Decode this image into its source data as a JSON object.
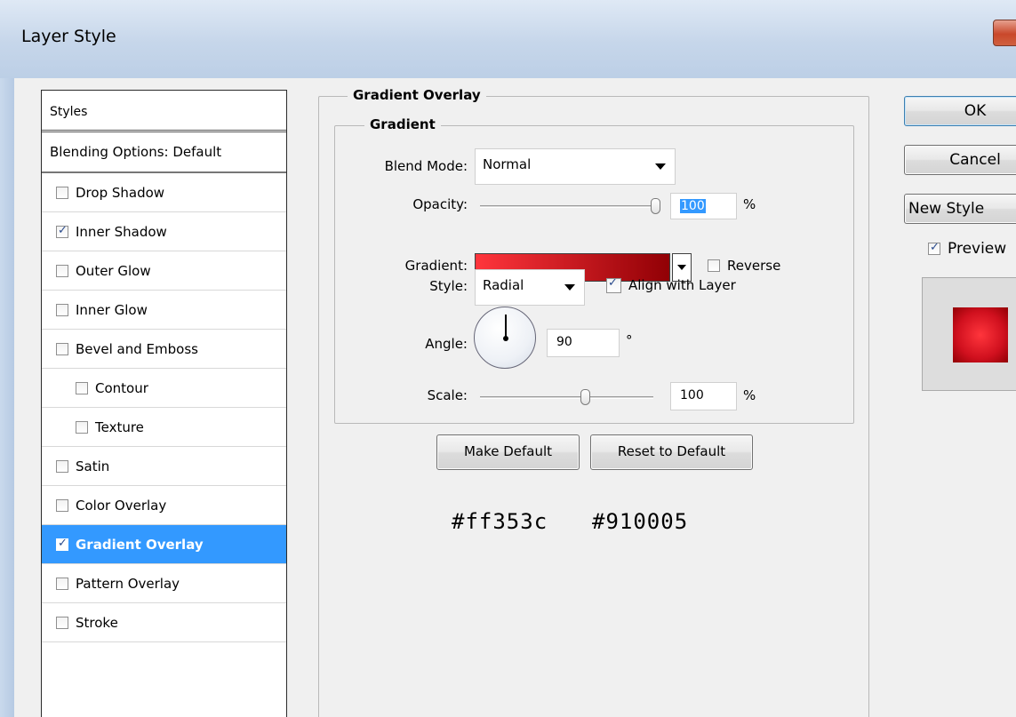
{
  "window": {
    "title": "Layer Style"
  },
  "styles_list": {
    "header": "Styles",
    "blending_options": "Blending Options: Default",
    "items": [
      {
        "label": "Drop Shadow",
        "checked": false,
        "sub": false,
        "selected": false
      },
      {
        "label": "Inner Shadow",
        "checked": true,
        "sub": false,
        "selected": false
      },
      {
        "label": "Outer Glow",
        "checked": false,
        "sub": false,
        "selected": false
      },
      {
        "label": "Inner Glow",
        "checked": false,
        "sub": false,
        "selected": false
      },
      {
        "label": "Bevel and Emboss",
        "checked": false,
        "sub": false,
        "selected": false
      },
      {
        "label": "Contour",
        "checked": false,
        "sub": true,
        "selected": false
      },
      {
        "label": "Texture",
        "checked": false,
        "sub": true,
        "selected": false
      },
      {
        "label": "Satin",
        "checked": false,
        "sub": false,
        "selected": false
      },
      {
        "label": "Color Overlay",
        "checked": false,
        "sub": false,
        "selected": false
      },
      {
        "label": "Gradient Overlay",
        "checked": true,
        "sub": false,
        "selected": true
      },
      {
        "label": "Pattern Overlay",
        "checked": false,
        "sub": false,
        "selected": false
      },
      {
        "label": "Stroke",
        "checked": false,
        "sub": false,
        "selected": false
      }
    ]
  },
  "gradient_overlay": {
    "section_title": "Gradient Overlay",
    "group_title": "Gradient",
    "blend_mode_label": "Blend Mode:",
    "blend_mode_value": "Normal",
    "opacity_label": "Opacity:",
    "opacity_value": "100",
    "opacity_level": 1.0,
    "percent": "%",
    "gradient_label": "Gradient:",
    "gradient_start_color": "#ff353c",
    "gradient_end_color": "#910005",
    "reverse_label": "Reverse",
    "reverse_checked": false,
    "style_label": "Style:",
    "style_value": "Radial",
    "align_label": "Align with Layer",
    "align_checked": true,
    "angle_label": "Angle:",
    "angle_value": "90",
    "degree_symbol": "°",
    "scale_label": "Scale:",
    "scale_value": "100",
    "make_default": "Make Default",
    "reset_default": "Reset to Default"
  },
  "annotations": {
    "color1": "#ff353c",
    "color2": "#910005"
  },
  "buttons": {
    "ok": "OK",
    "cancel": "Cancel",
    "new_style": "New Style",
    "preview_label": "Preview",
    "preview_checked": true
  }
}
